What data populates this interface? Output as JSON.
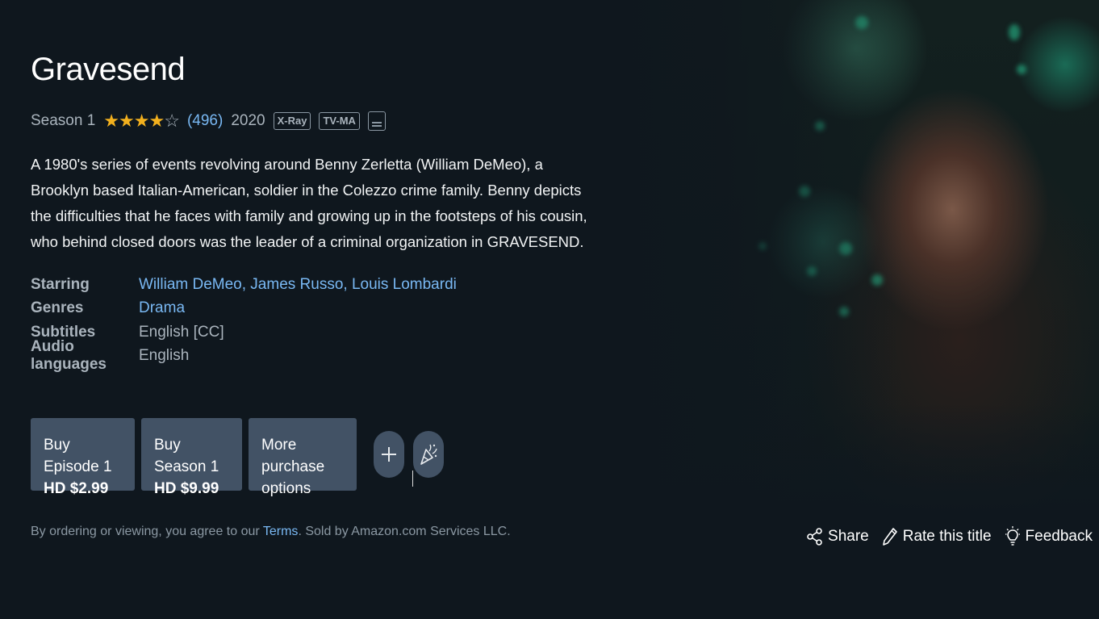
{
  "title": "Gravesend",
  "meta": {
    "season": "Season 1",
    "rating_stars": 4,
    "rating_max": 5,
    "rating_count": "(496)",
    "year": "2020",
    "badges": [
      "X-Ray",
      "TV-MA"
    ],
    "subtitle_icon": "subtitles-icon"
  },
  "synopsis": "A 1980's series of events revolving around Benny Zerletta (William DeMeo), a Brooklyn based Italian-American, soldier in the Colezzo crime family. Benny depicts the difficulties that he faces with family and growing up in the footsteps of his cousin, who behind closed doors was the leader of a criminal organization in GRAVESEND.",
  "details": {
    "starring_label": "Starring",
    "starring_value": "William DeMeo, James Russo, Louis Lombardi",
    "genres_label": "Genres",
    "genres_value": "Drama",
    "subtitles_label": "Subtitles",
    "subtitles_value": "English [CC]",
    "audio_label": "Audio languages",
    "audio_value": "English"
  },
  "buttons": {
    "buy_episode_line1": "Buy Episode 1",
    "buy_episode_price": "HD $2.99",
    "buy_season_line1": "Buy Season 1",
    "buy_season_price": "HD $9.99",
    "more_line1": "More purchase",
    "more_line2": "options",
    "watchlist_icon": "plus-icon",
    "party_icon": "watch-party-icon"
  },
  "legal": {
    "prefix": "By ordering or viewing, you agree to our ",
    "terms_link": "Terms",
    "suffix": ". Sold by Amazon.com Services LLC."
  },
  "actions": {
    "share": "Share",
    "rate": "Rate this title",
    "feedback": "Feedback"
  },
  "colors": {
    "background": "#0f171e",
    "button": "#425265",
    "link": "#79b8f3",
    "star": "#f2b01e"
  }
}
